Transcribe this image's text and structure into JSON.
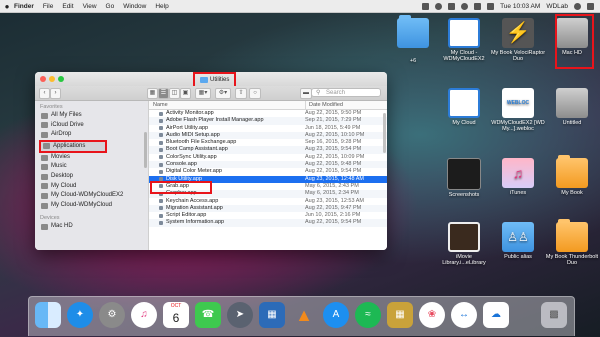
{
  "menubar": {
    "apple": "",
    "app_name": "Finder",
    "items": [
      "File",
      "Edit",
      "View",
      "Go",
      "Window",
      "Help"
    ],
    "clock": "Tue 10:03 AM",
    "user": "WDLab"
  },
  "finder": {
    "title": "Utilities",
    "search_placeholder": "Search",
    "sidebar": {
      "favorites_header": "Favorites",
      "favorites": [
        "All My Files",
        "iCloud Drive",
        "AirDrop",
        "Applications",
        "Movies",
        "Music",
        "Desktop",
        "My Cloud",
        "My Cloud-WDMyCloudEX2",
        "My Cloud-WDMyCloud"
      ],
      "selected": "Applications",
      "devices_header": "Devices",
      "devices": [
        "Mac HD"
      ]
    },
    "columns": {
      "name": "Name",
      "date": "Date Modified"
    },
    "rows": [
      {
        "name": "Activity Monitor.app",
        "date": "Aug 22, 2015, 9:50 PM"
      },
      {
        "name": "Adobe Flash Player Install Manager.app",
        "date": "Sep 21, 2015, 7:29 PM"
      },
      {
        "name": "AirPort Utility.app",
        "date": "Jun 18, 2015, 5:49 PM"
      },
      {
        "name": "Audio MIDI Setup.app",
        "date": "Aug 22, 2015, 10:10 PM"
      },
      {
        "name": "Bluetooth File Exchange.app",
        "date": "Sep 16, 2015, 9:28 PM"
      },
      {
        "name": "Boot Camp Assistant.app",
        "date": "Aug 23, 2015, 9:54 PM"
      },
      {
        "name": "ColorSync Utility.app",
        "date": "Aug 22, 2015, 10:09 PM"
      },
      {
        "name": "Console.app",
        "date": "Aug 22, 2015, 9:48 PM"
      },
      {
        "name": "Digital Color Meter.app",
        "date": "Aug 22, 2015, 9:54 PM"
      },
      {
        "name": "Disk Utility.app",
        "date": "Aug 23, 2015, 12:48 AM"
      },
      {
        "name": "Grab.app",
        "date": "May 6, 2015, 2:43 PM"
      },
      {
        "name": "Grapher.app",
        "date": "May 6, 2015, 2:34 PM"
      },
      {
        "name": "Keychain Access.app",
        "date": "Aug 23, 2015, 12:53 AM"
      },
      {
        "name": "Migration Assistant.app",
        "date": "Aug 22, 2015, 9:47 PM"
      },
      {
        "name": "Script Editor.app",
        "date": "Jun 10, 2015, 2:16 PM"
      },
      {
        "name": "System Information.app",
        "date": "Aug 22, 2015, 9:54 PM"
      }
    ],
    "selected_row": "Disk Utility.app"
  },
  "desktop": {
    "icons": [
      {
        "label": "+6"
      },
      {
        "label": "My Cloud - WDMyCloudEX2"
      },
      {
        "label": "My Book VelociRaptor Duo"
      },
      {
        "label": "Mac HD"
      },
      {
        "label": "My Cloud"
      },
      {
        "label": "WDMyCloudEX2 [WD My...].webloc"
      },
      {
        "label": "Untitled"
      },
      {
        "label": "Screenshots"
      },
      {
        "label": "iTunes"
      },
      {
        "label": "My Book"
      },
      {
        "label": "iMovie Library.i...eLibrary"
      },
      {
        "label": "Public alias"
      },
      {
        "label": "My Book Thunderbolt Duo"
      }
    ],
    "webloc_text": "WEBLOC",
    "highlight": "Mac HD"
  },
  "dock": {
    "apps": [
      "finder-icon",
      "safari-icon",
      "system-preferences-icon",
      "itunes-icon",
      "calendar-icon",
      "facetime-icon",
      "launchpad-icon",
      "photo-booth-icon",
      "vlc-icon",
      "app-store-icon",
      "spotify-icon",
      "archive-utility-icon",
      "photos-icon",
      "teamviewer-icon",
      "wd-sync-icon",
      "trash-icon"
    ],
    "calendar_month": "OCT",
    "calendar_day": "6"
  },
  "colors": {
    "highlight": "#e8141b",
    "selection": "#1c6ff0",
    "folder": "#5ba8ef"
  }
}
